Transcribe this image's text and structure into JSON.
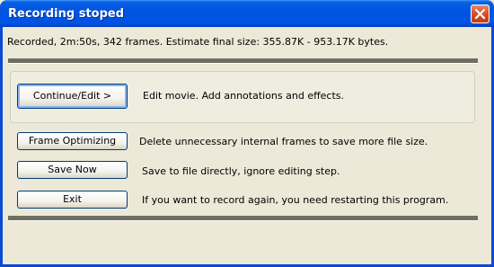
{
  "window": {
    "title": "Recording stoped"
  },
  "summary": "Recorded, 2m:50s, 342 frames. Estimate final size: 355.87K - 953.17K bytes.",
  "actions": [
    {
      "label": "Continue/Edit >",
      "description": "Edit movie. Add annotations and effects."
    },
    {
      "label": "Frame Optimizing",
      "description": "Delete unnecessary internal frames to save more file size."
    },
    {
      "label": "Save Now",
      "description": "Save to file directly, ignore editing step."
    },
    {
      "label": "Exit",
      "description": "If you want to record again, you need restarting this program."
    }
  ],
  "colors": {
    "titlebar": "#0054e3",
    "close": "#d9502b",
    "face": "#ece9d8"
  }
}
